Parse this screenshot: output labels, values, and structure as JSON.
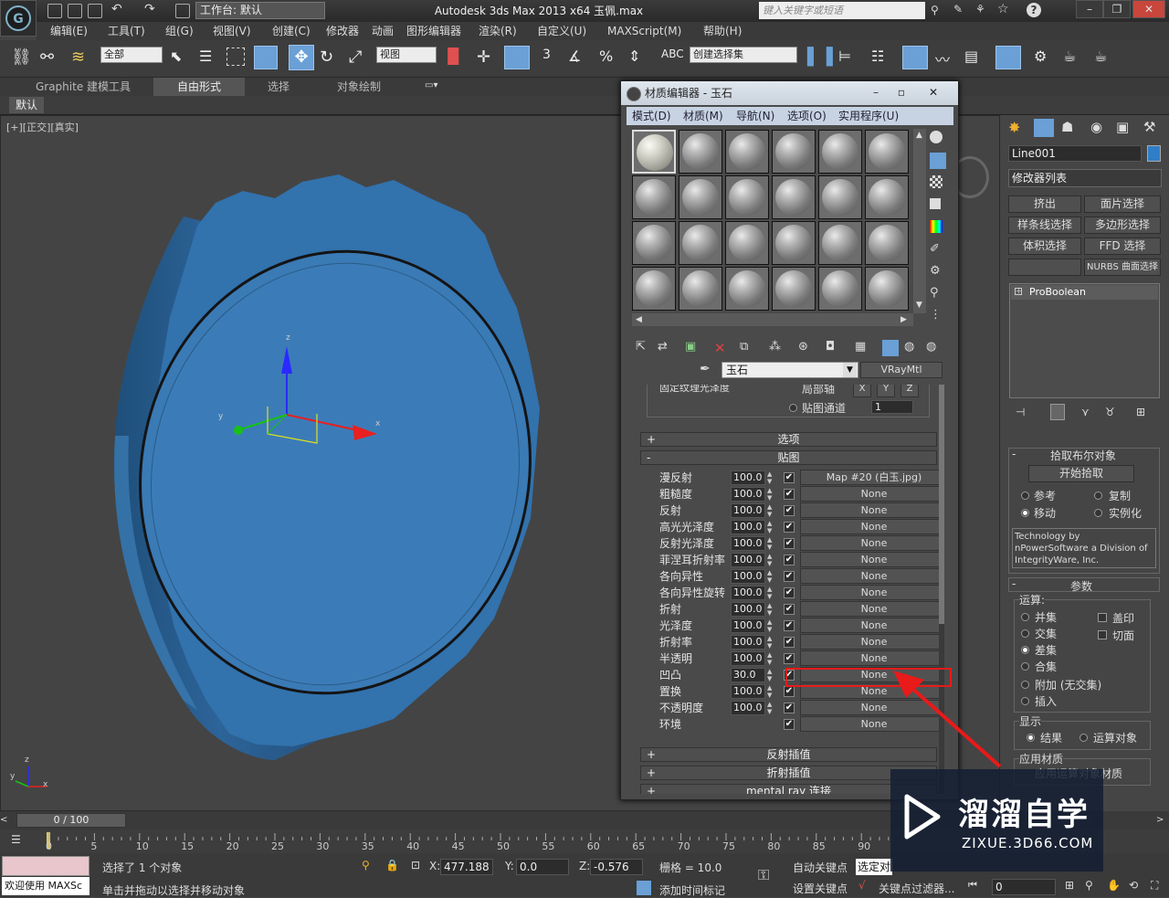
{
  "titlebar": {
    "app_title": "Autodesk 3ds Max  2013 x64      玉佩.max",
    "workspace": "工作台: 默认",
    "search_placeholder": "键入关键字或短语"
  },
  "menu": [
    "编辑(E)",
    "工具(T)",
    "组(G)",
    "视图(V)",
    "创建(C)",
    "修改器",
    "动画",
    "图形编辑器",
    "渲染(R)",
    "自定义(U)",
    "MAXScript(M)",
    "帮助(H)"
  ],
  "toolbar": {
    "selection_filter": "全部",
    "ref_coord": "视图",
    "named_selection": "创建选择集",
    "snap_num": "3"
  },
  "ribbon": {
    "tabs": [
      "Graphite 建模工具",
      "自由形式",
      "选择",
      "对象绘制"
    ],
    "sub_label": "默认"
  },
  "viewport": {
    "label": "[+][正交][真实]",
    "gizmo_z": "z",
    "gizmo_x": "x",
    "gizmo_y": "y",
    "corner_z": "z",
    "corner_x": "x",
    "corner_y": "y"
  },
  "material_editor": {
    "title": "材质编辑器 - 玉石",
    "menu": [
      "模式(D)",
      "材质(M)",
      "导航(N)",
      "选项(O)",
      "实用程序(U)"
    ],
    "material_name": "玉石",
    "material_type": "VRayMtl",
    "partial_row": "固定纹理光泽度",
    "local_label": "局部轴",
    "local_buttons": [
      "X",
      "Y",
      "Z"
    ],
    "map_channel_label": "贴图通道",
    "map_channel_value": "1",
    "rollouts_top": [
      {
        "pm": "+",
        "label": "选项"
      },
      {
        "pm": "-",
        "label": "贴图"
      }
    ],
    "maps": [
      {
        "label": "漫反射",
        "value": "100.0",
        "checked": "✔",
        "map": "Map #20 (白玉.jpg)"
      },
      {
        "label": "粗糙度",
        "value": "100.0",
        "checked": "✔",
        "map": "None"
      },
      {
        "label": "反射",
        "value": "100.0",
        "checked": "✔",
        "map": "None"
      },
      {
        "label": "高光光泽度",
        "value": "100.0",
        "checked": "✔",
        "map": "None"
      },
      {
        "label": "反射光泽度",
        "value": "100.0",
        "checked": "✔",
        "map": "None"
      },
      {
        "label": "菲涅耳折射率",
        "value": "100.0",
        "checked": "✔",
        "map": "None"
      },
      {
        "label": "各向异性",
        "value": "100.0",
        "checked": "✔",
        "map": "None"
      },
      {
        "label": "各向异性旋转",
        "value": "100.0",
        "checked": "✔",
        "map": "None"
      },
      {
        "label": "折射",
        "value": "100.0",
        "checked": "✔",
        "map": "None"
      },
      {
        "label": "光泽度",
        "value": "100.0",
        "checked": "✔",
        "map": "None"
      },
      {
        "label": "折射率",
        "value": "100.0",
        "checked": "✔",
        "map": "None"
      },
      {
        "label": "半透明",
        "value": "100.0",
        "checked": "✔",
        "map": "None"
      },
      {
        "label": "凹凸",
        "value": "30.0",
        "checked": "✔",
        "map": "None"
      },
      {
        "label": "置换",
        "value": "100.0",
        "checked": "✔",
        "map": "None"
      },
      {
        "label": "不透明度",
        "value": "100.0",
        "checked": "✔",
        "map": "None"
      },
      {
        "label": "环境",
        "value": "",
        "checked": "✔",
        "map": "None"
      }
    ],
    "rollouts_bottom": [
      {
        "pm": "+",
        "label": "反射插值"
      },
      {
        "pm": "+",
        "label": "折射插值"
      },
      {
        "pm": "+",
        "label": "mental ray 连接"
      }
    ]
  },
  "command_panel": {
    "object_name": "Line001",
    "modifier_list": "修改器列表",
    "mod_buttons": [
      "挤出",
      "面片选择",
      "样条线选择",
      "多边形选择",
      "体积选择",
      "FFD 选择",
      "",
      "NURBS 曲面选择"
    ],
    "stack_item": "ProBoolean",
    "pick_title": "拾取布尔对象",
    "start_pick": "开始拾取",
    "ref_label": "参考",
    "copy_label": "复制",
    "move_label": "移动",
    "instance_label": "实例化",
    "credit": "Technology by nPowerSoftware a Division of IntegrityWare, Inc.",
    "params_title": "参数",
    "ops_label": "运算:",
    "ops": [
      "并集",
      "交集",
      "差集",
      "合集",
      "附加 (无交集)",
      "插入"
    ],
    "imprint": "盖印",
    "cut": "切面",
    "display_label": "显示",
    "result": "结果",
    "operands": "运算对象",
    "apply_material": "应用材质",
    "apply_material_item": "应用运算对象材质"
  },
  "timeline": {
    "frame": "0 / 100",
    "ticks": [
      "0",
      "5",
      "10",
      "15",
      "20",
      "25",
      "30",
      "35",
      "40",
      "45",
      "50",
      "55",
      "60",
      "65",
      "70",
      "75",
      "80",
      "85",
      "90"
    ]
  },
  "status": {
    "selected": "选择了 1 个对象",
    "hint": "单击并拖动以选择并移动对象",
    "welcome": "欢迎使用 MAXSc",
    "x_label": "X:",
    "x": "477.188",
    "y_label": "Y:",
    "y": "0.0",
    "z_label": "Z:",
    "z": "-0.576",
    "grid": "栅格 = 10.0",
    "add_time_tag": "添加时间标记",
    "auto_key": "自动关键点",
    "set_key": "设置关键点",
    "selected_obj": "选定对",
    "key_filters": "关键点过滤器...",
    "frame_field": "0"
  },
  "watermark": {
    "brand": "溜溜自学",
    "url": "ZIXUE.3D66.COM"
  },
  "colors": {
    "highlight_red": "#e81a1a",
    "object_blue": "#2f6fa6"
  }
}
